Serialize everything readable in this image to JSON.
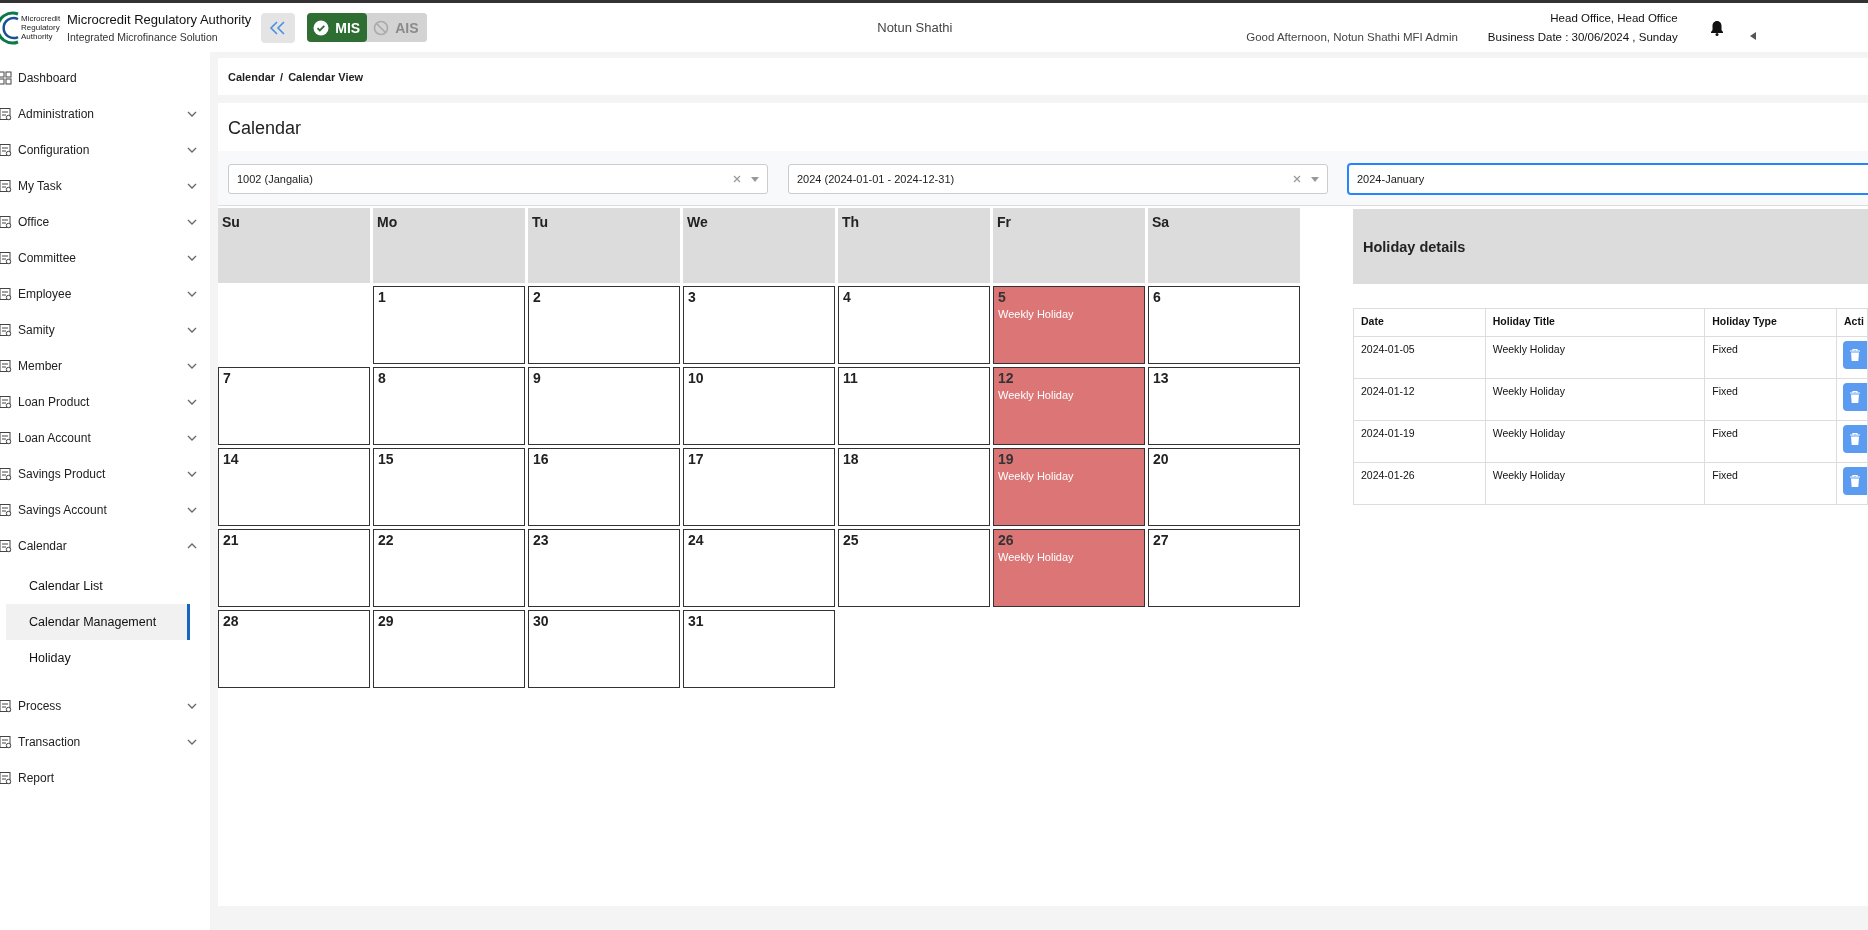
{
  "header": {
    "org_name": "Microcredit Regulatory Authority",
    "org_subtitle": "Integrated Microfinance Solution",
    "logo_text": "Microcredit Regulatory Authority",
    "modules": [
      {
        "label": "MIS",
        "selected": true
      },
      {
        "label": "AIS",
        "selected": false
      }
    ],
    "institution": "Notun Shathi",
    "greeting": "Good Afternoon, Notun Shathi MFI Admin",
    "office": "Head Office, Head Office",
    "business_date": "Business Date : 30/06/2024 , Sunday"
  },
  "sidebar": {
    "items": [
      {
        "label": "Dashboard",
        "expandable": false
      },
      {
        "label": "Administration",
        "expandable": true,
        "expanded": false
      },
      {
        "label": "Configuration",
        "expandable": true,
        "expanded": false
      },
      {
        "label": "My Task",
        "expandable": true,
        "expanded": false
      },
      {
        "label": "Office",
        "expandable": true,
        "expanded": false
      },
      {
        "label": "Committee",
        "expandable": true,
        "expanded": false
      },
      {
        "label": "Employee",
        "expandable": true,
        "expanded": false
      },
      {
        "label": "Samity",
        "expandable": true,
        "expanded": false
      },
      {
        "label": "Member",
        "expandable": true,
        "expanded": false
      },
      {
        "label": "Loan Product",
        "expandable": true,
        "expanded": false
      },
      {
        "label": "Loan Account",
        "expandable": true,
        "expanded": false
      },
      {
        "label": "Savings Product",
        "expandable": true,
        "expanded": false
      },
      {
        "label": "Savings Account",
        "expandable": true,
        "expanded": false
      },
      {
        "label": "Calendar",
        "expandable": true,
        "expanded": true,
        "children": [
          {
            "label": "Calendar List",
            "selected": false
          },
          {
            "label": "Calendar Management",
            "selected": true
          },
          {
            "label": "Holiday",
            "selected": false
          }
        ]
      },
      {
        "label": "Process",
        "expandable": true,
        "expanded": false
      },
      {
        "label": "Transaction",
        "expandable": true,
        "expanded": false
      },
      {
        "label": "Report",
        "expandable": false
      }
    ]
  },
  "breadcrumb": {
    "items": [
      "Calendar",
      "Calendar View"
    ],
    "separator": "/"
  },
  "page_title": "Calendar",
  "filters": [
    {
      "value": "1002 (Jangalia)",
      "focused": false,
      "caret": true
    },
    {
      "value": "2024 (2024-01-01 - 2024-12-31)",
      "focused": false,
      "caret": true
    },
    {
      "value": "2024-January",
      "focused": true,
      "caret": false
    }
  ],
  "calendar": {
    "weekdays": [
      "Su",
      "Mo",
      "Tu",
      "We",
      "Th",
      "Fr",
      "Sa"
    ],
    "weeks": [
      [
        {
          "kind": "blank"
        },
        {
          "day": "1",
          "holiday": false
        },
        {
          "day": "2",
          "holiday": false
        },
        {
          "day": "3",
          "holiday": false
        },
        {
          "day": "4",
          "holiday": false
        },
        {
          "day": "5",
          "holiday": true,
          "note": "Weekly Holiday"
        },
        {
          "day": "6",
          "holiday": false
        }
      ],
      [
        {
          "day": "7",
          "holiday": false
        },
        {
          "day": "8",
          "holiday": false
        },
        {
          "day": "9",
          "holiday": false
        },
        {
          "day": "10",
          "holiday": false
        },
        {
          "day": "11",
          "holiday": false
        },
        {
          "day": "12",
          "holiday": true,
          "note": "Weekly Holiday"
        },
        {
          "day": "13",
          "holiday": false
        }
      ],
      [
        {
          "day": "14",
          "holiday": false
        },
        {
          "day": "15",
          "holiday": false
        },
        {
          "day": "16",
          "holiday": false
        },
        {
          "day": "17",
          "holiday": false
        },
        {
          "day": "18",
          "holiday": false
        },
        {
          "day": "19",
          "holiday": true,
          "note": "Weekly Holiday"
        },
        {
          "day": "20",
          "holiday": false
        }
      ],
      [
        {
          "day": "21",
          "holiday": false
        },
        {
          "day": "22",
          "holiday": false
        },
        {
          "day": "23",
          "holiday": false
        },
        {
          "day": "24",
          "holiday": false
        },
        {
          "day": "25",
          "holiday": false
        },
        {
          "day": "26",
          "holiday": true,
          "note": "Weekly Holiday"
        },
        {
          "day": "27",
          "holiday": false
        }
      ],
      [
        {
          "day": "28",
          "holiday": false
        },
        {
          "day": "29",
          "holiday": false
        },
        {
          "day": "30",
          "holiday": false
        },
        {
          "day": "31",
          "holiday": false
        }
      ]
    ]
  },
  "holiday_details": {
    "title": "Holiday details",
    "columns": [
      "Date",
      "Holiday Title",
      "Holiday Type",
      "Acti"
    ],
    "rows": [
      {
        "date": "2024-01-05",
        "title": "Weekly Holiday",
        "type": "Fixed"
      },
      {
        "date": "2024-01-12",
        "title": "Weekly Holiday",
        "type": "Fixed"
      },
      {
        "date": "2024-01-19",
        "title": "Weekly Holiday",
        "type": "Fixed"
      },
      {
        "date": "2024-01-26",
        "title": "Weekly Holiday",
        "type": "Fixed"
      }
    ]
  }
}
